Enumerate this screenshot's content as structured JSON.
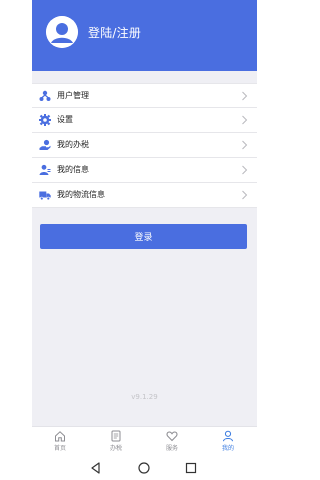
{
  "header": {
    "title": "登陆/注册",
    "background_color": "#4a6ee0"
  },
  "menu": {
    "items": [
      {
        "label": "用户管理",
        "icon": "user-management-icon"
      },
      {
        "label": "设置",
        "icon": "gear-icon"
      },
      {
        "label": "我的办税",
        "icon": "hand-coin-icon"
      },
      {
        "label": "我的信息",
        "icon": "user-info-icon"
      },
      {
        "label": "我的物流信息",
        "icon": "truck-icon"
      }
    ]
  },
  "login_button": {
    "label": "登录",
    "color": "#4a6ee0"
  },
  "version": "v9.1.29",
  "tabbar": {
    "tabs": [
      {
        "label": "首页",
        "icon": "home-icon"
      },
      {
        "label": "办税",
        "icon": "document-icon"
      },
      {
        "label": "服务",
        "icon": "heart-icon"
      },
      {
        "label": "我的",
        "icon": "person-icon"
      }
    ],
    "active_color": "#3a7be0"
  },
  "system_nav": {
    "buttons": [
      "back-icon",
      "home-circle-icon",
      "recents-icon"
    ]
  }
}
